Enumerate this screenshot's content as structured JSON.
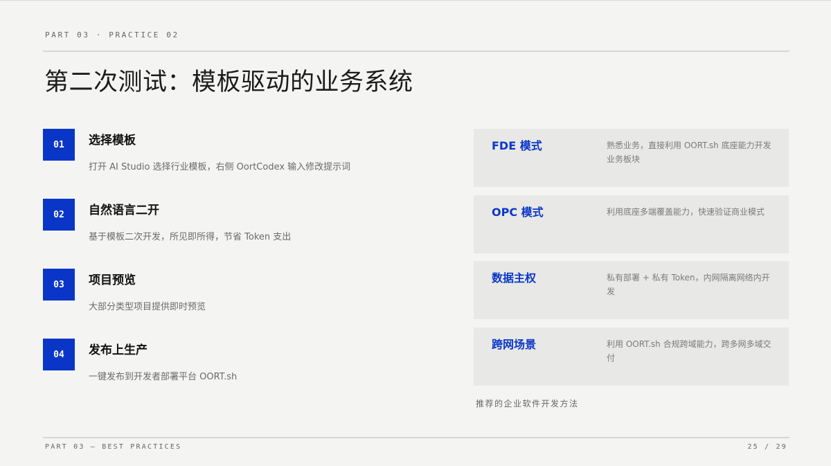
{
  "header": {
    "kicker": "PART 03 · PRACTICE 02",
    "title": "第二次测试：模板驱动的业务系统"
  },
  "steps": [
    {
      "num": "01",
      "title": "选择模板",
      "desc": "打开 AI Studio 选择行业模板，右侧 OortCodex 输入修改提示词"
    },
    {
      "num": "02",
      "title": "自然语言二开",
      "desc": "基于模板二次开发，所见即所得，节省 Token 支出"
    },
    {
      "num": "03",
      "title": "项目预览",
      "desc": "大部分类型项目提供即时预览"
    },
    {
      "num": "04",
      "title": "发布上生产",
      "desc": "一键发布到开发者部署平台 OORT.sh"
    }
  ],
  "cards": [
    {
      "title": "FDE 模式",
      "desc": "熟悉业务，直接利用 OORT.sh 底座能力开发业务板块"
    },
    {
      "title": "OPC 模式",
      "desc": "利用底座多端覆盖能力，快速验证商业模式"
    },
    {
      "title": "数据主权",
      "desc": "私有部署 + 私有 Token，内网隔离网络内开发"
    },
    {
      "title": "跨网场景",
      "desc": "利用 OORT.sh 合规跨域能力，跨多网多域交付"
    }
  ],
  "caption": "推荐的企业软件开发方法",
  "footer": {
    "left": "PART 03 — BEST PRACTICES",
    "page": "25 / 29"
  },
  "colors": {
    "accent": "#0a36c8",
    "background": "#f4f4f2",
    "card_background": "#e8e8e6"
  }
}
